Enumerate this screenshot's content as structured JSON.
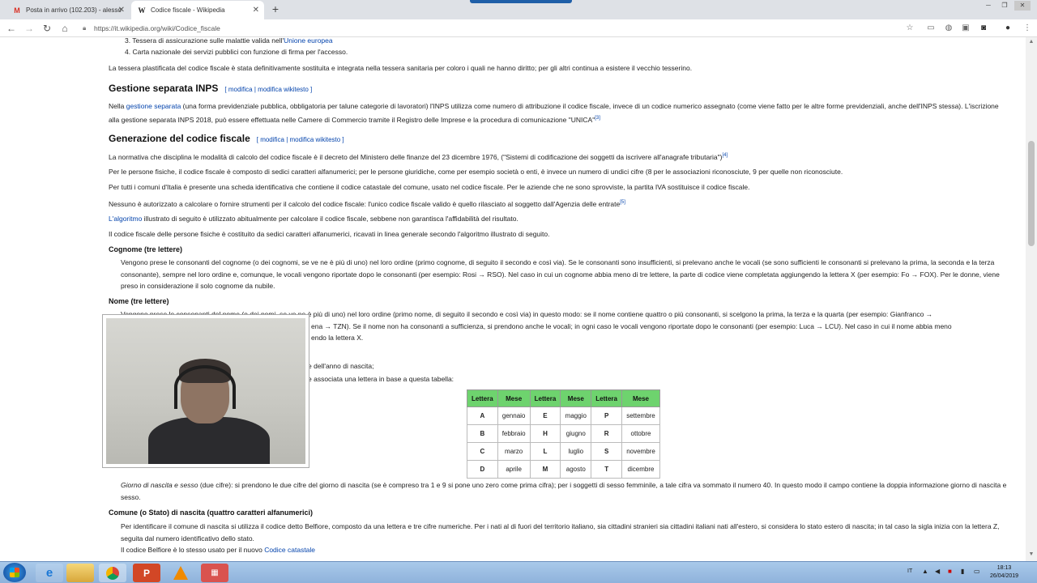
{
  "browser": {
    "tabs": [
      {
        "label": "Posta in arrivo (102.203) - alesso",
        "icon": "gmail-icon"
      },
      {
        "label": "Codice fiscale - Wikipedia",
        "icon": "wikipedia-icon"
      }
    ],
    "url": "https://it.wikipedia.org/wiki/Codice_fiscale"
  },
  "article": {
    "list_item_3": "Tessera di assicurazione sulle malattie valida nell'",
    "list_item_3_link": "Unione europea",
    "list_item_4": "Carta nazionale dei servizi pubblici con funzione di firma per l'accesso.",
    "tessera_para": "La tessera plastificata del codice fiscale è stata definitivamente sostituita e integrata nella tessera sanitaria per coloro i quali ne hanno diritto; per gli altri continua a esistere il vecchio tesserino.",
    "section_inps": "Gestione separata INPS",
    "edit_label": "[ modifica | modifica wikitesto ]",
    "inps_para_1": "Nella ",
    "inps_link": "gestione separata",
    "inps_para_2": " (una forma previdenziale pubblica, obbligatoria per talune categorie di lavoratori) l'INPS utilizza come numero di attribuzione il codice fiscale, invece di un codice numerico assegnato (come viene fatto per le altre forme previdenziali, anche dell'INPS stessa). L'iscrizione alla gestione separata INPS 2018, può essere effettuata nelle Camere di Commercio tramite il Registro delle Imprese e la procedura di comunicazione \"UNICA\"",
    "inps_ref": "[3]",
    "section_gen": "Generazione del codice fiscale",
    "gen_para_1": "La normativa che disciplina le modalità di calcolo del codice fiscale è il decreto del Ministero delle finanze del 23 dicembre 1976, (\"Sistemi di codificazione dei soggetti da iscrivere all'anagrafe tributaria\")",
    "gen_ref_1": "[4]",
    "gen_para_2": "Per le persone fisiche, il codice fiscale è composto di sedici caratteri alfanumerici; per le persone giuridiche, come per esempio società o enti, è invece un numero di undici cifre (8 per le associazioni riconosciute, 9 per quelle non riconosciute.",
    "gen_para_3": "Per tutti i comuni d'Italia è presente una scheda identificativa che contiene il codice catastale del comune, usato nel codice fiscale. Per le aziende che ne sono sprovviste, la partita IVA sostituisce il codice fiscale.",
    "gen_para_4": "Nessuno è autorizzato a calcolare o fornire strumenti per il calcolo del codice fiscale: l'unico codice fiscale valido è quello rilasciato al soggetto dall'Agenzia delle entrate",
    "gen_ref_4": "[5]",
    "gen_para_5_link": "L'algoritmo",
    "gen_para_5": " illustrato di seguito è utilizzato abitualmente per calcolare il codice fiscale, sebbene non garantisca l'affidabilità del risultato.",
    "gen_para_6": "Il codice fiscale delle persone fisiche è costituito da sedici caratteri alfanumerici, ricavati in linea generale secondo l'algoritmo illustrato di seguito.",
    "h_cognome": "Cognome (tre lettere)",
    "cognome_para": "Vengono prese le consonanti del cognome (o dei cognomi, se ve ne è più di uno) nel loro ordine (primo cognome, di seguito il secondo e così via). Se le consonanti sono insufficienti, si prelevano anche le vocali (se sono sufficienti le consonanti si prelevano la prima, la seconda e la terza consonante), sempre nel loro ordine e, comunque, le vocali vengono riportate dopo le consonanti (per esempio: Rosi → RSO). Nel caso in cui un cognome abbia meno di tre lettere, la parte di codice viene completata aggiungendo la lettera X (per esempio: Fo → FOX). Per le donne, viene preso in considerazione il solo cognome da nubile.",
    "h_nome": "Nome (tre lettere)",
    "nome_line_1": "Vengono prese le consonanti del nome (o dei nomi, se ve ne è più di uno) nel loro ordine (primo nome, di seguito il secondo e così via) in questo modo: se il nome contiene quattro o più consonanti, si scelgono la prima, la terza e la quarta (per esempio: Gianfranco →",
    "nome_line_2": "ena → TZN). Se il nome non ha consonanti a sufficienza, si prendono anche le vocali; in ogni caso le vocali vengono riportate dopo le consonanti (per esempio: Luca → LCU). Nel caso in cui il nome abbia meno",
    "nome_line_3": "endo la lettera X.",
    "anno_fragment": "e dell'anno di nascita;",
    "mese_fragment": "e associata una lettera in base a questa tabella:",
    "giorno_para_it": "Giorno di nascita e sesso",
    "giorno_para": " (due cifre): si prendono le due cifre del giorno di nascita (se è compreso tra 1 e 9 si pone uno zero come prima cifra); per i soggetti di sesso femminile, a tale cifra va sommato il numero 40. In questo modo il campo contiene la doppia informazione giorno di nascita e sesso.",
    "h_comune": "Comune (o Stato) di nascita (quattro caratteri alfanumerici)",
    "comune_para": "Per identificare il comune di nascita si utilizza il codice detto Belfiore, composto da una lettera e tre cifre numeriche. Per i nati al di fuori del territorio italiano, sia cittadini stranieri sia cittadini italiani nati all'estero, si considera lo stato estero di nascita; in tal caso la sigla inizia con la lettera Z, seguita dal numero identificativo dello stato.",
    "belfiore_para": "Il codice Belfiore è lo stesso usato per il nuovo ",
    "belfiore_link": "Codice catastale"
  },
  "months_table": {
    "headers": [
      "Lettera",
      "Mese",
      "Lettera",
      "Mese",
      "Lettera",
      "Mese"
    ],
    "rows": [
      [
        "A",
        "gennaio",
        "E",
        "maggio",
        "P",
        "settembre"
      ],
      [
        "B",
        "febbraio",
        "H",
        "giugno",
        "R",
        "ottobre"
      ],
      [
        "C",
        "marzo",
        "L",
        "luglio",
        "S",
        "novembre"
      ],
      [
        "D",
        "aprile",
        "M",
        "agosto",
        "T",
        "dicembre"
      ]
    ]
  },
  "taskbar": {
    "apps": [
      "ie-icon",
      "explorer-icon",
      "chrome-icon",
      "powerpoint-icon",
      "vlc-icon",
      "calendar-app-icon"
    ],
    "language": "IT",
    "time": "18:13",
    "date": "26/04/2019"
  }
}
